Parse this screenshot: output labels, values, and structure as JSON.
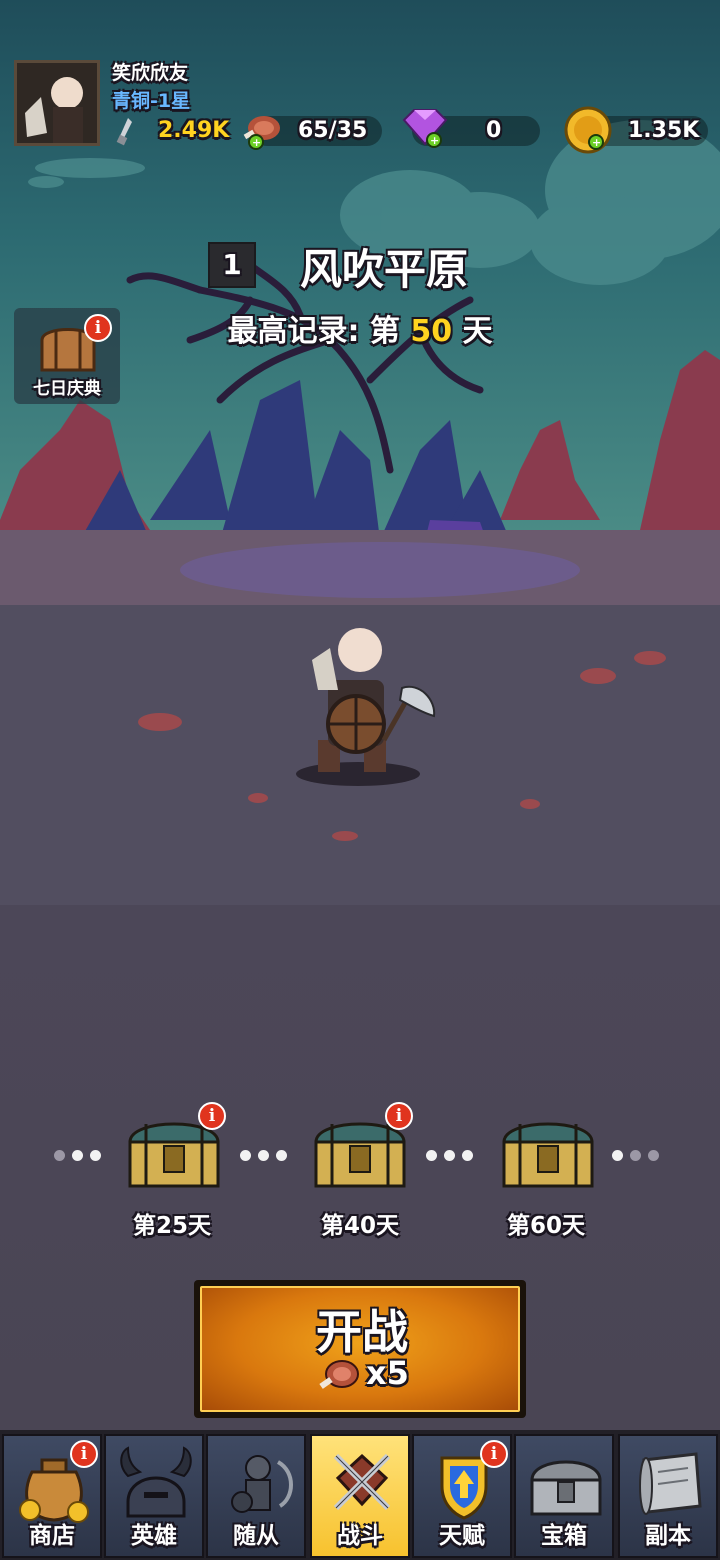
{
  "player": {
    "name": "笑欣欣友",
    "rank": "青铜-1星"
  },
  "resources": {
    "power": "2.49K",
    "stamina": "65/35",
    "gems": "0",
    "gold": "1.35K"
  },
  "stage": {
    "number": "1",
    "name": "风吹平原",
    "record_prefix": "最高记录: 第 ",
    "record_days": "50",
    "record_suffix": " 天"
  },
  "event": {
    "label": "七日庆典"
  },
  "milestones": [
    {
      "label": "第25天",
      "badge": "i"
    },
    {
      "label": "第40天",
      "badge": "i"
    },
    {
      "label": "第60天",
      "badge": ""
    }
  ],
  "battle": {
    "label": "开战",
    "cost": "x5"
  },
  "tabs": [
    {
      "label": "商店",
      "badge": "i",
      "icon": "money-bag-icon"
    },
    {
      "label": "英雄",
      "badge": "",
      "icon": "helmet-icon"
    },
    {
      "label": "随从",
      "badge": "",
      "icon": "minion-icon"
    },
    {
      "label": "战斗",
      "badge": "",
      "icon": "crossed-swords-icon",
      "active": true
    },
    {
      "label": "天赋",
      "badge": "i",
      "icon": "talent-shield-icon"
    },
    {
      "label": "宝箱",
      "badge": "",
      "icon": "chest-icon"
    },
    {
      "label": "副本",
      "badge": "",
      "icon": "scroll-icon"
    }
  ],
  "colors": {
    "accent_gold": "#ffd320",
    "rank_blue": "#69b7ff",
    "battle_orange": "#e88a12",
    "active_tab": "#f7c22e"
  }
}
